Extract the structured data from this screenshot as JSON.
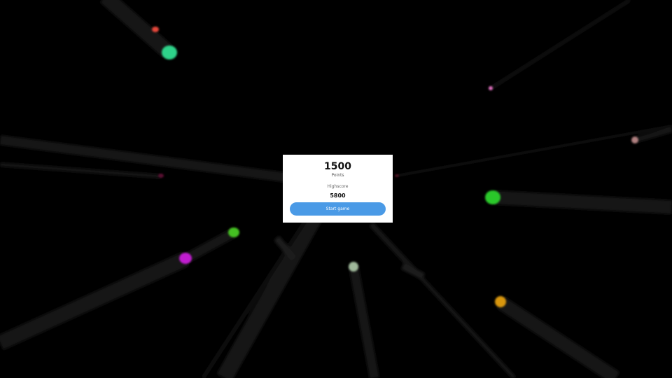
{
  "game": {
    "score": "1500",
    "score_label": "Points",
    "highscore_label": "Highscore",
    "highscore": "5800",
    "start_button_label": "Start game"
  },
  "colors": {
    "background": "#000000",
    "panel": "#ffffff",
    "button": "#4a9ae6",
    "button_text": "#ffffff"
  }
}
